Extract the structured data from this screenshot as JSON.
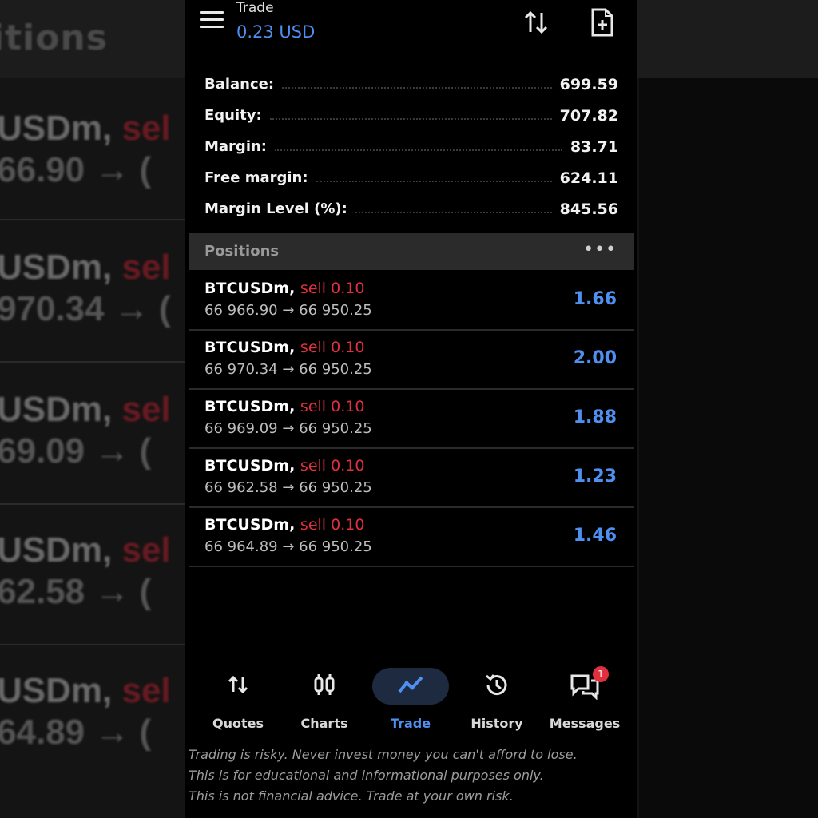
{
  "background": {
    "title_fragment": "itions",
    "rows": [
      {
        "symbol": "USDm,",
        "side": "sel",
        "prices": "66.90 → ("
      },
      {
        "symbol": "USDm,",
        "side": "sel",
        "prices": "970.34 → ("
      },
      {
        "symbol": "USDm,",
        "side": "sel",
        "prices": "69.09 → ("
      },
      {
        "symbol": "USDm,",
        "side": "sel",
        "prices": "62.58 → ("
      },
      {
        "symbol": "USDm,",
        "side": "sel",
        "prices": "64.89 → ("
      }
    ]
  },
  "header": {
    "title": "Trade",
    "value": "0.23 USD",
    "sort_icon": "sort-arrows-icon",
    "new_order_icon": "new-document-icon"
  },
  "summary": [
    {
      "label": "Balance:",
      "value": "699.59"
    },
    {
      "label": "Equity:",
      "value": "707.82"
    },
    {
      "label": "Margin:",
      "value": "83.71"
    },
    {
      "label": "Free margin:",
      "value": "624.11"
    },
    {
      "label": "Margin Level (%):",
      "value": "845.56"
    }
  ],
  "positions_header": {
    "title": "Positions",
    "more": "•••"
  },
  "positions": [
    {
      "symbol": "BTCUSDm,",
      "side": "sell 0.10",
      "prices": "66 966.90 → 66 950.25",
      "profit": "1.66"
    },
    {
      "symbol": "BTCUSDm,",
      "side": "sell 0.10",
      "prices": "66 970.34 → 66 950.25",
      "profit": "2.00"
    },
    {
      "symbol": "BTCUSDm,",
      "side": "sell 0.10",
      "prices": "66 969.09 → 66 950.25",
      "profit": "1.88"
    },
    {
      "symbol": "BTCUSDm,",
      "side": "sell 0.10",
      "prices": "66 962.58 → 66 950.25",
      "profit": "1.23"
    },
    {
      "symbol": "BTCUSDm,",
      "side": "sell 0.10",
      "prices": "66 964.89 → 66 950.25",
      "profit": "1.46"
    }
  ],
  "nav": [
    {
      "label": "Quotes",
      "icon": "quotes-icon"
    },
    {
      "label": "Charts",
      "icon": "charts-icon"
    },
    {
      "label": "Trade",
      "icon": "trade-icon",
      "active": true
    },
    {
      "label": "History",
      "icon": "history-icon"
    },
    {
      "label": "Messages",
      "icon": "messages-icon",
      "badge": "1"
    }
  ],
  "disclaimer": {
    "line1": "Trading is risky. Never invest money you can't afford to lose.",
    "line2": "This is for educational and informational purposes only.",
    "line3": "This is not financial advice. Trade at your own risk."
  },
  "colors": {
    "accent": "#4f8ff0",
    "sell": "#e0303e",
    "background": "#000000"
  }
}
